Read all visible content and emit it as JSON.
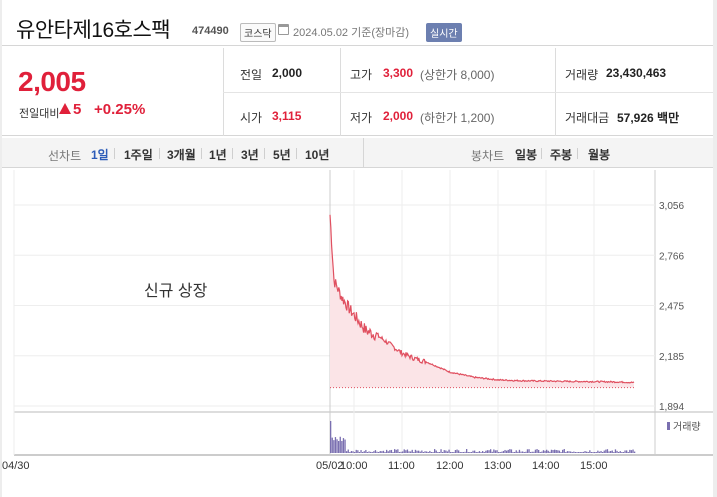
{
  "header": {
    "stock_name": "유안타제16호스팩",
    "stock_code": "474490",
    "market": "코스닥",
    "date_info": "2024.05.02  기준(장마감)",
    "realtime_label": "실시간"
  },
  "quote": {
    "price": "2,005",
    "change_label": "전일대비",
    "change_value": "5",
    "change_percent": "+0.25%",
    "direction": "up",
    "prev_close_label": "전일",
    "prev_close": "2,000",
    "high_label": "고가",
    "high": "3,300",
    "upper_limit": "(상한가 8,000)",
    "volume_label": "거래량",
    "volume": "23,430,463",
    "open_label": "시가",
    "open": "3,115",
    "low_label": "저가",
    "low": "2,000",
    "lower_limit": "(하한가 1,200)",
    "trade_value_label": "거래대금",
    "trade_value": "57,926 백만"
  },
  "tabs": {
    "line_chart_label": "선차트",
    "line_periods": [
      "1일",
      "1주일",
      "3개월",
      "1년",
      "3년",
      "5년",
      "10년"
    ],
    "active_period": "1일",
    "candle_chart_label": "봉차트",
    "candle_periods": [
      "일봉",
      "주봉",
      "월봉"
    ]
  },
  "chart_data": {
    "type": "line",
    "annotation": "신규 상장",
    "volume_legend": "거래량",
    "y_ticks": [
      "3,056",
      "2,766",
      "2,475",
      "2,185",
      "1,894"
    ],
    "ylim": [
      1894,
      3056
    ],
    "x_ticks": [
      "04/30",
      "05/02",
      "10:00",
      "11:00",
      "12:00",
      "13:00",
      "14:00",
      "15:00"
    ],
    "x_minutes": [
      0,
      5,
      15,
      25,
      35,
      45,
      60,
      75,
      90,
      105,
      120,
      150,
      180,
      210,
      240,
      270,
      300,
      330,
      360,
      380
    ],
    "prices": [
      3000,
      2620,
      2520,
      2450,
      2390,
      2330,
      2300,
      2250,
      2200,
      2170,
      2150,
      2090,
      2060,
      2045,
      2040,
      2038,
      2036,
      2035,
      2033,
      2030
    ],
    "baseline": 2000,
    "line_color": "#e05060",
    "volume_color": "#7a6fb0"
  }
}
